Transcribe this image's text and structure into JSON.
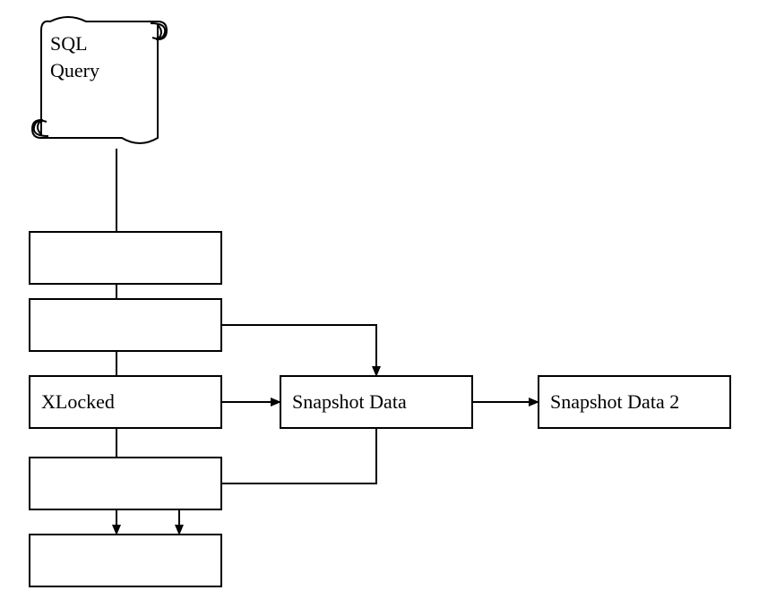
{
  "diagram": {
    "scroll": {
      "line1": "SQL",
      "line2": "Query"
    },
    "boxes": {
      "b1_label": "",
      "b2_label": "",
      "b3_label": "XLocked",
      "b4_label": "Snapshot Data",
      "b5_label": "Snapshot Data 2",
      "b6_label": "",
      "b7_label": ""
    },
    "arrows": [
      {
        "from": "scroll",
        "to": "box7",
        "desc": "sql-query down through stack to bottom box"
      },
      {
        "from": "box2",
        "to": "box4",
        "desc": "second box across to snapshot-data"
      },
      {
        "from": "box3",
        "to": "box4",
        "desc": "xlocked to snapshot-data"
      },
      {
        "from": "box4",
        "to": "box5",
        "desc": "snapshot-data to snapshot-data-2"
      },
      {
        "from": "box4",
        "to": "box7",
        "desc": "snapshot-data down and left into bottom box"
      }
    ]
  }
}
